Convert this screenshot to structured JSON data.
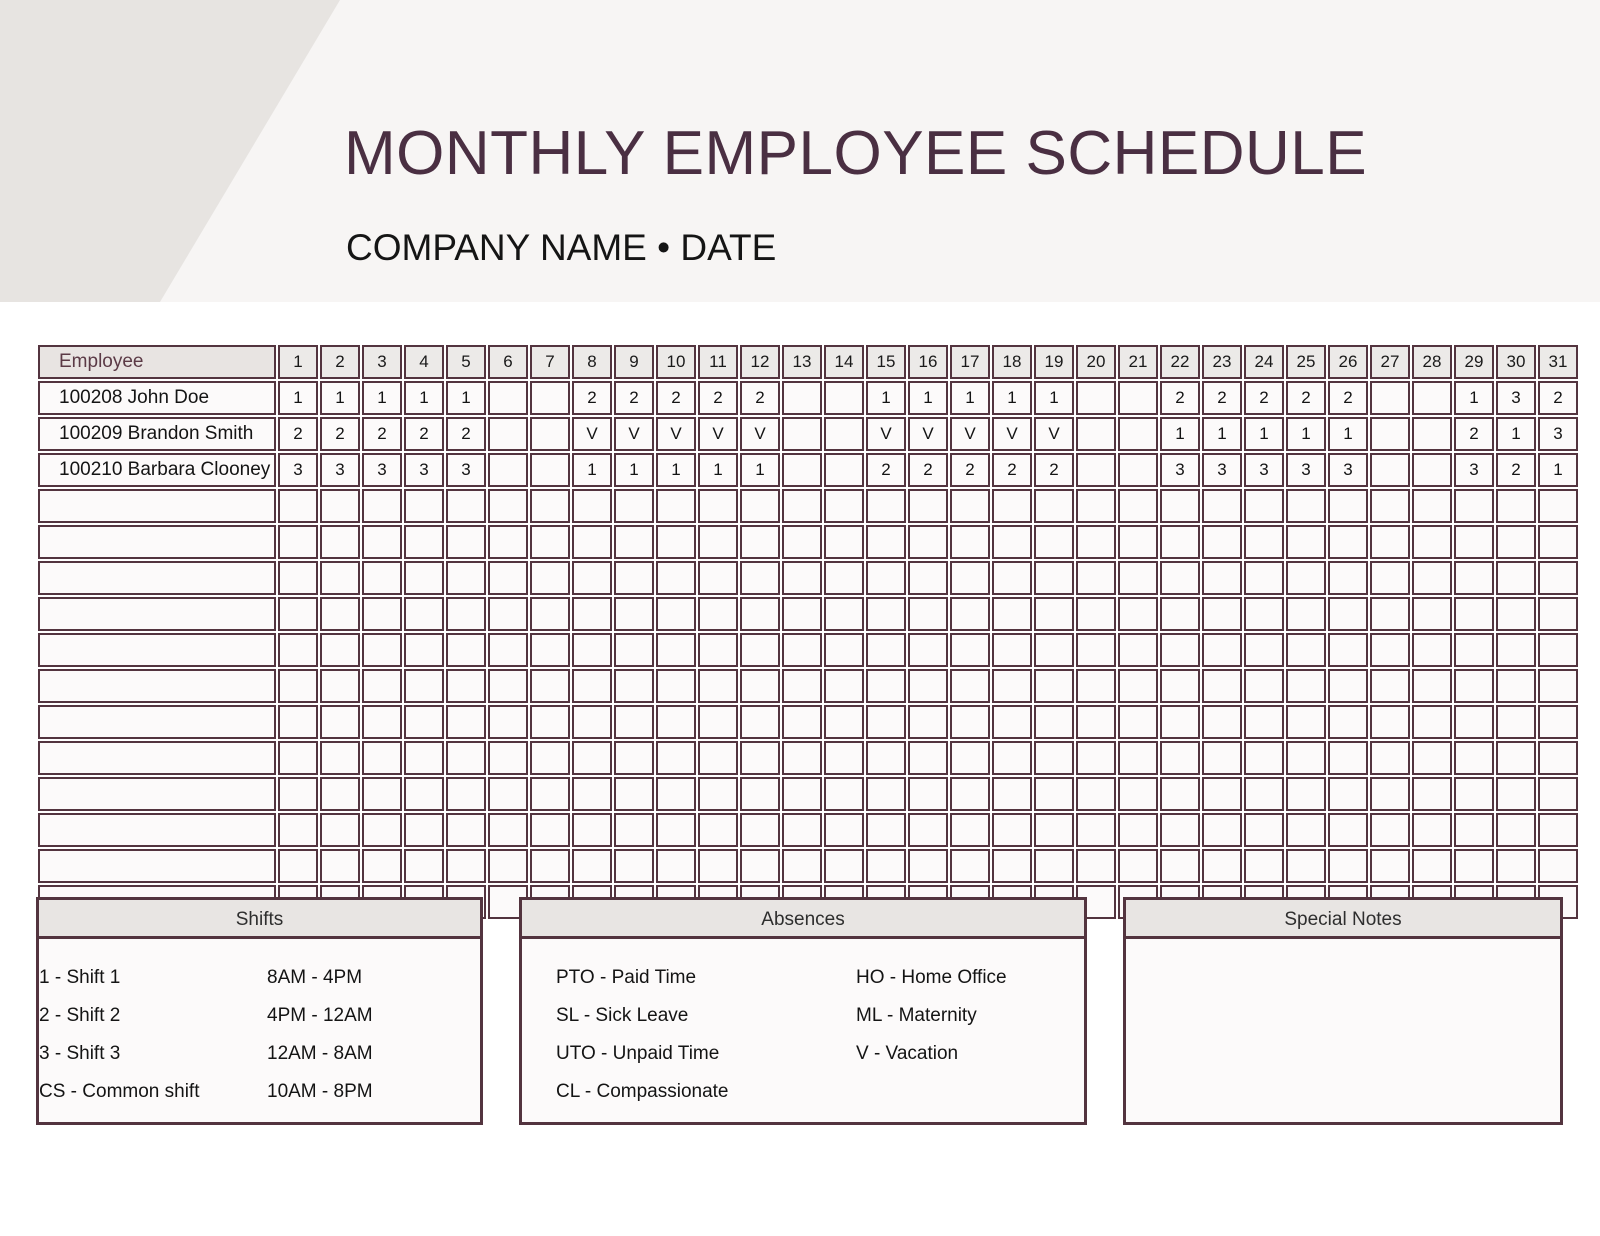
{
  "header": {
    "title": "MONTHLY EMPLOYEE SCHEDULE",
    "subtitle": "COMPANY NAME • DATE",
    "title_color": "#4a2f42",
    "band_color": "#f7f5f4",
    "wedge_color": "#e7e4e1"
  },
  "schedule": {
    "employee_header": "Employee",
    "days": [
      "1",
      "2",
      "3",
      "4",
      "5",
      "6",
      "7",
      "8",
      "9",
      "10",
      "11",
      "12",
      "13",
      "14",
      "15",
      "16",
      "17",
      "18",
      "19",
      "20",
      "21",
      "22",
      "23",
      "24",
      "25",
      "26",
      "27",
      "28",
      "29",
      "30",
      "31"
    ],
    "rows": [
      {
        "name": "100208 John Doe",
        "cells": [
          "1",
          "1",
          "1",
          "1",
          "1",
          "",
          "",
          "2",
          "2",
          "2",
          "2",
          "2",
          "",
          "",
          "1",
          "1",
          "1",
          "1",
          "1",
          "",
          "",
          "2",
          "2",
          "2",
          "2",
          "2",
          "",
          "",
          "1",
          "3",
          "2"
        ]
      },
      {
        "name": "100209 Brandon Smith",
        "cells": [
          "2",
          "2",
          "2",
          "2",
          "2",
          "",
          "",
          "V",
          "V",
          "V",
          "V",
          "V",
          "",
          "",
          "V",
          "V",
          "V",
          "V",
          "V",
          "",
          "",
          "1",
          "1",
          "1",
          "1",
          "1",
          "",
          "",
          "2",
          "1",
          "3"
        ]
      },
      {
        "name": "100210 Barbara Clooney",
        "cells": [
          "3",
          "3",
          "3",
          "3",
          "3",
          "",
          "",
          "1",
          "1",
          "1",
          "1",
          "1",
          "",
          "",
          "2",
          "2",
          "2",
          "2",
          "2",
          "",
          "",
          "3",
          "3",
          "3",
          "3",
          "3",
          "",
          "",
          "3",
          "2",
          "1"
        ]
      },
      {
        "name": "",
        "cells": [
          "",
          "",
          "",
          "",
          "",
          "",
          "",
          "",
          "",
          "",
          "",
          "",
          "",
          "",
          "",
          "",
          "",
          "",
          "",
          "",
          "",
          "",
          "",
          "",
          "",
          "",
          "",
          "",
          "",
          "",
          ""
        ]
      },
      {
        "name": "",
        "cells": [
          "",
          "",
          "",
          "",
          "",
          "",
          "",
          "",
          "",
          "",
          "",
          "",
          "",
          "",
          "",
          "",
          "",
          "",
          "",
          "",
          "",
          "",
          "",
          "",
          "",
          "",
          "",
          "",
          "",
          "",
          ""
        ]
      },
      {
        "name": "",
        "cells": [
          "",
          "",
          "",
          "",
          "",
          "",
          "",
          "",
          "",
          "",
          "",
          "",
          "",
          "",
          "",
          "",
          "",
          "",
          "",
          "",
          "",
          "",
          "",
          "",
          "",
          "",
          "",
          "",
          "",
          "",
          ""
        ]
      },
      {
        "name": "",
        "cells": [
          "",
          "",
          "",
          "",
          "",
          "",
          "",
          "",
          "",
          "",
          "",
          "",
          "",
          "",
          "",
          "",
          "",
          "",
          "",
          "",
          "",
          "",
          "",
          "",
          "",
          "",
          "",
          "",
          "",
          "",
          ""
        ]
      },
      {
        "name": "",
        "cells": [
          "",
          "",
          "",
          "",
          "",
          "",
          "",
          "",
          "",
          "",
          "",
          "",
          "",
          "",
          "",
          "",
          "",
          "",
          "",
          "",
          "",
          "",
          "",
          "",
          "",
          "",
          "",
          "",
          "",
          "",
          ""
        ]
      },
      {
        "name": "",
        "cells": [
          "",
          "",
          "",
          "",
          "",
          "",
          "",
          "",
          "",
          "",
          "",
          "",
          "",
          "",
          "",
          "",
          "",
          "",
          "",
          "",
          "",
          "",
          "",
          "",
          "",
          "",
          "",
          "",
          "",
          "",
          ""
        ]
      },
      {
        "name": "",
        "cells": [
          "",
          "",
          "",
          "",
          "",
          "",
          "",
          "",
          "",
          "",
          "",
          "",
          "",
          "",
          "",
          "",
          "",
          "",
          "",
          "",
          "",
          "",
          "",
          "",
          "",
          "",
          "",
          "",
          "",
          "",
          ""
        ]
      },
      {
        "name": "",
        "cells": [
          "",
          "",
          "",
          "",
          "",
          "",
          "",
          "",
          "",
          "",
          "",
          "",
          "",
          "",
          "",
          "",
          "",
          "",
          "",
          "",
          "",
          "",
          "",
          "",
          "",
          "",
          "",
          "",
          "",
          "",
          ""
        ]
      },
      {
        "name": "",
        "cells": [
          "",
          "",
          "",
          "",
          "",
          "",
          "",
          "",
          "",
          "",
          "",
          "",
          "",
          "",
          "",
          "",
          "",
          "",
          "",
          "",
          "",
          "",
          "",
          "",
          "",
          "",
          "",
          "",
          "",
          "",
          ""
        ]
      },
      {
        "name": "",
        "cells": [
          "",
          "",
          "",
          "",
          "",
          "",
          "",
          "",
          "",
          "",
          "",
          "",
          "",
          "",
          "",
          "",
          "",
          "",
          "",
          "",
          "",
          "",
          "",
          "",
          "",
          "",
          "",
          "",
          "",
          "",
          ""
        ]
      },
      {
        "name": "",
        "cells": [
          "",
          "",
          "",
          "",
          "",
          "",
          "",
          "",
          "",
          "",
          "",
          "",
          "",
          "",
          "",
          "",
          "",
          "",
          "",
          "",
          "",
          "",
          "",
          "",
          "",
          "",
          "",
          "",
          "",
          "",
          ""
        ]
      },
      {
        "name": "",
        "cells": [
          "",
          "",
          "",
          "",
          "",
          "",
          "",
          "",
          "",
          "",
          "",
          "",
          "",
          "",
          "",
          "",
          "",
          "",
          "",
          "",
          "",
          "",
          "",
          "",
          "",
          "",
          "",
          "",
          "",
          "",
          ""
        ]
      }
    ]
  },
  "legend": {
    "shifts": {
      "title": "Shifts",
      "items": [
        {
          "label": "1 - Shift 1",
          "time": "8AM - 4PM"
        },
        {
          "label": "2 - Shift 2",
          "time": "4PM - 12AM"
        },
        {
          "label": "3 - Shift 3",
          "time": "12AM - 8AM"
        },
        {
          "label": "CS - Common shift",
          "time": "10AM - 8PM"
        }
      ]
    },
    "absences": {
      "title": "Absences",
      "left": [
        "PTO - Paid Time",
        "SL - Sick Leave",
        "UTO - Unpaid Time",
        "CL - Compassionate"
      ],
      "right": [
        "HO - Home Office",
        "ML - Maternity",
        "V - Vacation"
      ]
    },
    "notes": {
      "title": "Special Notes",
      "content": ""
    }
  },
  "colors": {
    "accent": "#53343f",
    "title": "#4a2f42",
    "header_cell": "#e8e4e2",
    "day_cell": "#eceae8",
    "cell_bg": "#fcfafa"
  }
}
